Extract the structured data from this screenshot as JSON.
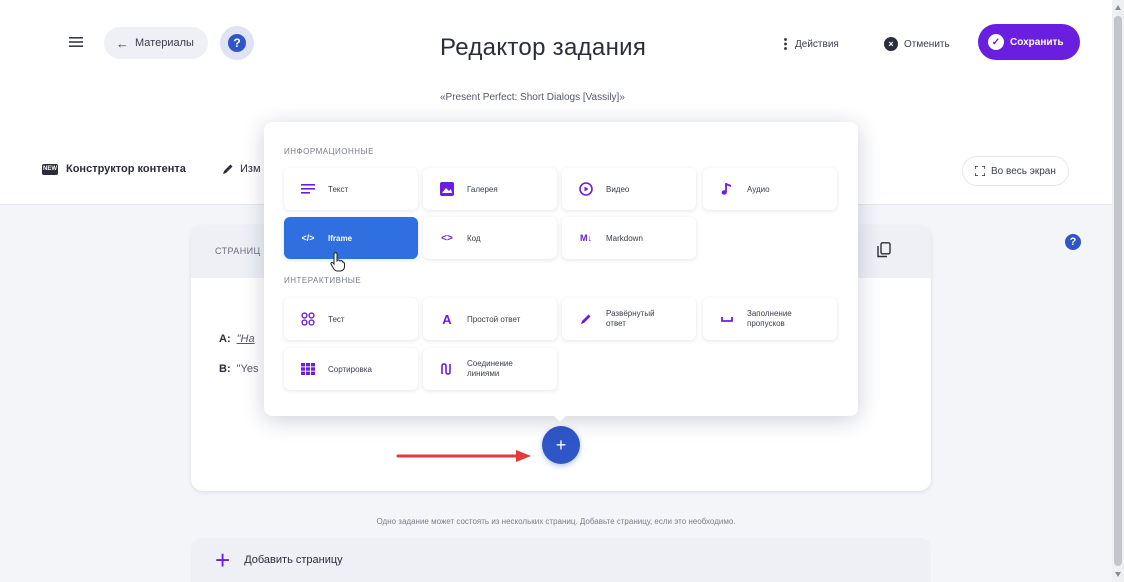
{
  "header": {
    "back_label": "Материалы",
    "title": "Редактор задания",
    "subtitle": "«Present Perfect: Short Dialogs [Vassily]»",
    "actions_label": "Действия",
    "cancel_label": "Отменить",
    "save_label": "Сохранить",
    "help_mark": "?"
  },
  "toolbar": {
    "constructor_label": "Конструктор контента",
    "constructor_badge": "NEW",
    "edit_label": "Изм",
    "fullscreen_label": "Во весь экран"
  },
  "card": {
    "label": "СТРАНИЦ",
    "lines": [
      {
        "speaker": "A:",
        "text": "\"Ha"
      },
      {
        "speaker": "B:",
        "text": "\"Yes"
      }
    ],
    "add_button": "+"
  },
  "popup": {
    "section_info": "ИНФОРМАЦИОННЫЕ",
    "section_interactive": "ИНТЕРАКТИВНЫЕ",
    "info_items": [
      {
        "label": "Текст",
        "icon": "text-lines-icon"
      },
      {
        "label": "Галерея",
        "icon": "gallery-icon"
      },
      {
        "label": "Видео",
        "icon": "play-icon"
      },
      {
        "label": "Аудио",
        "icon": "music-note-icon"
      },
      {
        "label": "Iframe",
        "icon": "iframe-code-icon",
        "active": true
      },
      {
        "label": "Код",
        "icon": "code-brackets-icon"
      },
      {
        "label": "Markdown",
        "icon": "markdown-icon",
        "badge": "M↓"
      }
    ],
    "interactive_items": [
      {
        "label": "Тест",
        "icon": "test-grid-icon"
      },
      {
        "label": "Простой ответ",
        "icon": "simple-answer-icon"
      },
      {
        "label": "Развёрнутый ответ",
        "line1": "Развёрнутый",
        "line2": "ответ",
        "icon": "pen-icon"
      },
      {
        "label": "Заполнение пропусков",
        "line1": "Заполнение",
        "line2": "пропусков",
        "icon": "blank-fill-icon"
      },
      {
        "label": "Сортировка",
        "icon": "sort-grid-icon"
      },
      {
        "label": "Соединение линиями",
        "line1": "Соединение",
        "line2": "линиями",
        "icon": "connect-lines-icon"
      }
    ]
  },
  "footer": {
    "hint": "Одно задание может состоять из нескольких страниц. Добавьте страницу, если это необходимо.",
    "add_page_label": "Добавить страницу",
    "add_page_plus": "+"
  },
  "colors": {
    "primary_purple": "#6a1ee0",
    "primary_blue": "#2f56c8",
    "active_tile": "#2f6fe0",
    "arrow_red": "#e03a3a"
  }
}
